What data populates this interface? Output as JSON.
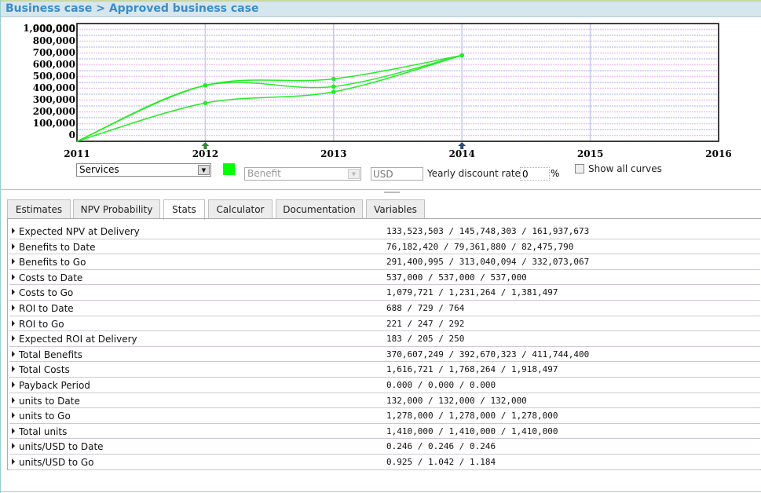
{
  "breadcrumb": "Business case > Approved business case",
  "chart_data": {
    "type": "line",
    "x": [
      2011,
      2012,
      2013,
      2014
    ],
    "xticks": [
      "2011",
      "2012",
      "2013",
      "2014",
      "2015",
      "2016"
    ],
    "xlim": [
      2011,
      2016
    ],
    "ylim": [
      0,
      1000000
    ],
    "yticks": [
      "0",
      "100,000",
      "200,000",
      "300,000",
      "400,000",
      "500,000",
      "600,000",
      "700,000",
      "800,000",
      "900,000",
      "1,000,000"
    ],
    "series": [
      {
        "values": [
          0,
          475000,
          530000,
          730000
        ]
      },
      {
        "values": [
          0,
          475000,
          465000,
          730000
        ]
      },
      {
        "values": [
          0,
          325000,
          420000,
          730000
        ]
      }
    ],
    "series_color": "#22ee22",
    "grid": true,
    "markers": [
      {
        "year": 2012,
        "color": "#2e8b2e"
      },
      {
        "year": 2014,
        "color": "#2b4a7a"
      }
    ]
  },
  "controls": {
    "category": "Services",
    "swatch_color": "#00ff00",
    "type": "Benefit",
    "currency_placeholder": "USD",
    "discount_label": "Yearly discount rate",
    "discount_value": "0",
    "percent": "%",
    "show_all_label": "Show all curves"
  },
  "tabs": [
    "Estimates",
    "NPV Probability",
    "Stats",
    "Calculator",
    "Documentation",
    "Variables"
  ],
  "active_tab": "Stats",
  "stats": [
    {
      "label": "Expected NPV at Delivery",
      "value": "133,523,503 / 145,748,303 / 161,937,673"
    },
    {
      "label": "Benefits to Date",
      "value": "76,182,420 / 79,361,880 / 82,475,790"
    },
    {
      "label": "Benefits to Go",
      "value": "291,400,995 / 313,040,094 / 332,073,067"
    },
    {
      "label": "Costs to Date",
      "value": "537,000 / 537,000 / 537,000"
    },
    {
      "label": "Costs to Go",
      "value": "1,079,721 / 1,231,264 / 1,381,497"
    },
    {
      "label": "ROI to Date",
      "value": "688 / 729 / 764"
    },
    {
      "label": "ROI to Go",
      "value": "221 / 247 / 292"
    },
    {
      "label": "Expected ROI at Delivery",
      "value": "183 / 205 / 250"
    },
    {
      "label": "Total Benefits",
      "value": "370,607,249 / 392,670,323 / 411,744,400"
    },
    {
      "label": "Total Costs",
      "value": "1,616,721 / 1,768,264 / 1,918,497"
    },
    {
      "label": "Payback Period",
      "value": "0.000 / 0.000 / 0.000"
    },
    {
      "label": "units to Date",
      "value": "132,000 / 132,000 / 132,000"
    },
    {
      "label": "units to Go",
      "value": "1,278,000 / 1,278,000 / 1,278,000"
    },
    {
      "label": "Total units",
      "value": "1,410,000 / 1,410,000 / 1,410,000"
    },
    {
      "label": "units/USD to Date",
      "value": "0.246 / 0.246 / 0.246"
    },
    {
      "label": "units/USD to Go",
      "value": "0.925 / 1.042 / 1.184"
    }
  ]
}
